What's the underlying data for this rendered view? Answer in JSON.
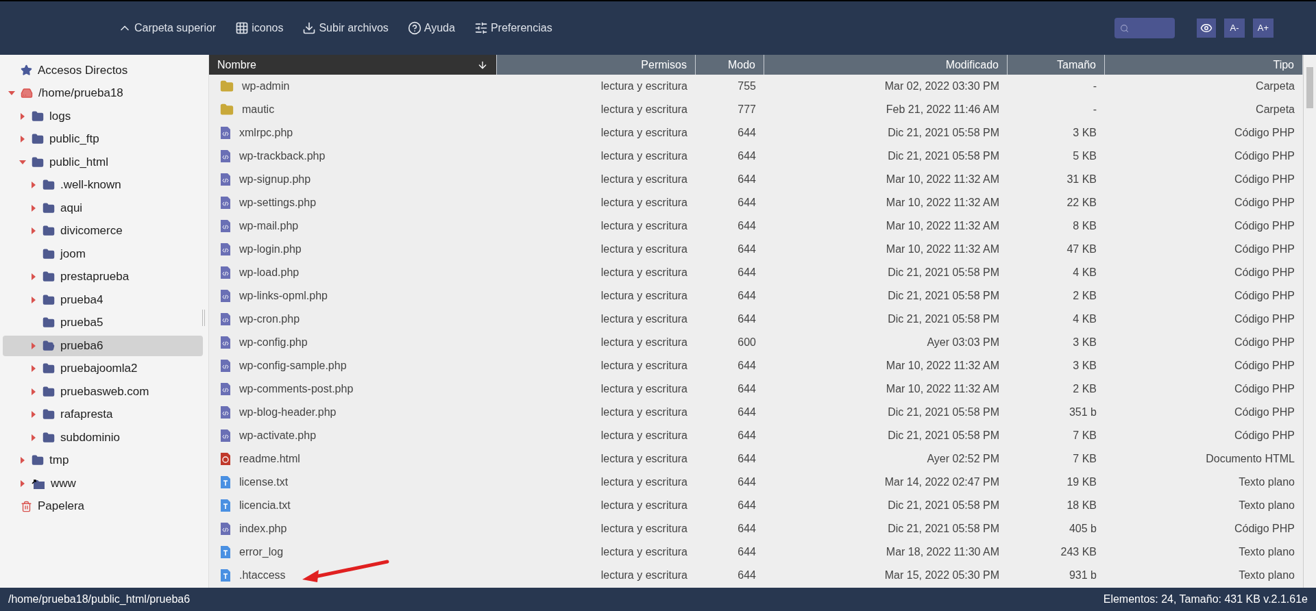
{
  "toolbar": {
    "buttons": [
      {
        "kind": "up",
        "label": "Carpeta superior"
      },
      {
        "kind": "grid",
        "label": "iconos"
      },
      {
        "kind": "upload",
        "label": "Subir archivos"
      },
      {
        "kind": "help",
        "label": "Ayuda"
      },
      {
        "kind": "prefs",
        "label": "Preferencias"
      }
    ],
    "font_buttons": [
      "A-",
      "A+"
    ]
  },
  "sidebar": {
    "items": [
      {
        "kind": "shortcut",
        "label": "Accesos Directos",
        "selected": false
      },
      {
        "kind": "drive",
        "label": "/home/prueba18",
        "expanded": true,
        "selected": false,
        "children": [
          {
            "kind": "folder",
            "label": "logs",
            "expanded": false,
            "selected": false
          },
          {
            "kind": "folder",
            "label": "public_ftp",
            "expanded": false,
            "selected": false
          },
          {
            "kind": "folder",
            "label": "public_html",
            "expanded": true,
            "selected": false,
            "children": [
              {
                "kind": "folder",
                "label": ".well-known",
                "expanded": false,
                "selected": false
              },
              {
                "kind": "folder",
                "label": "aqui",
                "expanded": false,
                "selected": false
              },
              {
                "kind": "folder",
                "label": "divicomerce",
                "expanded": false,
                "selected": false
              },
              {
                "kind": "folder",
                "label": "joom",
                "selected": false
              },
              {
                "kind": "folder",
                "label": "prestaprueba",
                "expanded": false,
                "selected": false
              },
              {
                "kind": "folder",
                "label": "prueba4",
                "expanded": false,
                "selected": false
              },
              {
                "kind": "folder",
                "label": "prueba5",
                "selected": false
              },
              {
                "kind": "folder",
                "label": "prueba6",
                "expanded": false,
                "selected": true
              },
              {
                "kind": "folder",
                "label": "pruebajoomla2",
                "expanded": false,
                "selected": false
              },
              {
                "kind": "folder",
                "label": "pruebasweb.com",
                "expanded": false,
                "selected": false
              },
              {
                "kind": "folder",
                "label": "rafapresta",
                "expanded": false,
                "selected": false
              },
              {
                "kind": "folder",
                "label": "subdominio",
                "expanded": false,
                "selected": false
              }
            ]
          },
          {
            "kind": "folder",
            "label": "tmp",
            "expanded": false,
            "selected": false
          },
          {
            "kind": "link",
            "label": "www",
            "expanded": false,
            "selected": false
          }
        ]
      },
      {
        "kind": "trash",
        "label": "Papelera",
        "selected": false
      }
    ]
  },
  "table": {
    "columns": [
      {
        "label": "Nombre",
        "sorted": true
      },
      {
        "label": "Permisos",
        "sorted": false
      },
      {
        "label": "Modo",
        "sorted": false
      },
      {
        "label": "Modificado",
        "sorted": false
      },
      {
        "label": "Tamaño",
        "sorted": false
      },
      {
        "label": "Tipo",
        "sorted": false
      }
    ],
    "rows": [
      {
        "kind": "folder",
        "name": "wp-admin",
        "permisos": "lectura y escritura",
        "modo": "755",
        "modificado": "Mar 02, 2022 03:30 PM",
        "tamano": "-",
        "tipo": "Carpeta"
      },
      {
        "kind": "folder",
        "name": "mautic",
        "permisos": "lectura y escritura",
        "modo": "777",
        "modificado": "Feb 21, 2022 11:46 AM",
        "tamano": "-",
        "tipo": "Carpeta"
      },
      {
        "kind": "php",
        "name": "xmlrpc.php",
        "permisos": "lectura y escritura",
        "modo": "644",
        "modificado": "Dic 21, 2021 05:58 PM",
        "tamano": "3 KB",
        "tipo": "Código PHP"
      },
      {
        "kind": "php",
        "name": "wp-trackback.php",
        "permisos": "lectura y escritura",
        "modo": "644",
        "modificado": "Dic 21, 2021 05:58 PM",
        "tamano": "5 KB",
        "tipo": "Código PHP"
      },
      {
        "kind": "php",
        "name": "wp-signup.php",
        "permisos": "lectura y escritura",
        "modo": "644",
        "modificado": "Mar 10, 2022 11:32 AM",
        "tamano": "31 KB",
        "tipo": "Código PHP"
      },
      {
        "kind": "php",
        "name": "wp-settings.php",
        "permisos": "lectura y escritura",
        "modo": "644",
        "modificado": "Mar 10, 2022 11:32 AM",
        "tamano": "22 KB",
        "tipo": "Código PHP"
      },
      {
        "kind": "php",
        "name": "wp-mail.php",
        "permisos": "lectura y escritura",
        "modo": "644",
        "modificado": "Mar 10, 2022 11:32 AM",
        "tamano": "8 KB",
        "tipo": "Código PHP"
      },
      {
        "kind": "php",
        "name": "wp-login.php",
        "permisos": "lectura y escritura",
        "modo": "644",
        "modificado": "Mar 10, 2022 11:32 AM",
        "tamano": "47 KB",
        "tipo": "Código PHP"
      },
      {
        "kind": "php",
        "name": "wp-load.php",
        "permisos": "lectura y escritura",
        "modo": "644",
        "modificado": "Dic 21, 2021 05:58 PM",
        "tamano": "4 KB",
        "tipo": "Código PHP"
      },
      {
        "kind": "php",
        "name": "wp-links-opml.php",
        "permisos": "lectura y escritura",
        "modo": "644",
        "modificado": "Dic 21, 2021 05:58 PM",
        "tamano": "2 KB",
        "tipo": "Código PHP"
      },
      {
        "kind": "php",
        "name": "wp-cron.php",
        "permisos": "lectura y escritura",
        "modo": "644",
        "modificado": "Dic 21, 2021 05:58 PM",
        "tamano": "4 KB",
        "tipo": "Código PHP"
      },
      {
        "kind": "php",
        "name": "wp-config.php",
        "permisos": "lectura y escritura",
        "modo": "600",
        "modificado": "Ayer 03:03 PM",
        "tamano": "3 KB",
        "tipo": "Código PHP"
      },
      {
        "kind": "php",
        "name": "wp-config-sample.php",
        "permisos": "lectura y escritura",
        "modo": "644",
        "modificado": "Mar 10, 2022 11:32 AM",
        "tamano": "3 KB",
        "tipo": "Código PHP"
      },
      {
        "kind": "php",
        "name": "wp-comments-post.php",
        "permisos": "lectura y escritura",
        "modo": "644",
        "modificado": "Mar 10, 2022 11:32 AM",
        "tamano": "2 KB",
        "tipo": "Código PHP"
      },
      {
        "kind": "php",
        "name": "wp-blog-header.php",
        "permisos": "lectura y escritura",
        "modo": "644",
        "modificado": "Dic 21, 2021 05:58 PM",
        "tamano": "351 b",
        "tipo": "Código PHP"
      },
      {
        "kind": "php",
        "name": "wp-activate.php",
        "permisos": "lectura y escritura",
        "modo": "644",
        "modificado": "Dic 21, 2021 05:58 PM",
        "tamano": "7 KB",
        "tipo": "Código PHP"
      },
      {
        "kind": "html",
        "name": "readme.html",
        "permisos": "lectura y escritura",
        "modo": "644",
        "modificado": "Ayer 02:52 PM",
        "tamano": "7 KB",
        "tipo": "Documento HTML"
      },
      {
        "kind": "text",
        "name": "license.txt",
        "permisos": "lectura y escritura",
        "modo": "644",
        "modificado": "Mar 14, 2022 02:47 PM",
        "tamano": "19 KB",
        "tipo": "Texto plano"
      },
      {
        "kind": "text",
        "name": "licencia.txt",
        "permisos": "lectura y escritura",
        "modo": "644",
        "modificado": "Dic 21, 2021 05:58 PM",
        "tamano": "18 KB",
        "tipo": "Texto plano"
      },
      {
        "kind": "php",
        "name": "index.php",
        "permisos": "lectura y escritura",
        "modo": "644",
        "modificado": "Dic 21, 2021 05:58 PM",
        "tamano": "405 b",
        "tipo": "Código PHP"
      },
      {
        "kind": "text",
        "name": "error_log",
        "permisos": "lectura y escritura",
        "modo": "644",
        "modificado": "Mar 18, 2022 11:30 AM",
        "tamano": "243 KB",
        "tipo": "Texto plano"
      },
      {
        "kind": "text",
        "name": ".htaccess",
        "permisos": "lectura y escritura",
        "modo": "644",
        "modificado": "Mar 15, 2022 05:30 PM",
        "tamano": "931 b",
        "tipo": "Texto plano",
        "annotated": true
      }
    ]
  },
  "status_bar": {
    "path": "/home/prueba18/public_html/prueba6",
    "summary": "Elementos: 24, Tamaño: 431 KB v.2.1.61e"
  }
}
